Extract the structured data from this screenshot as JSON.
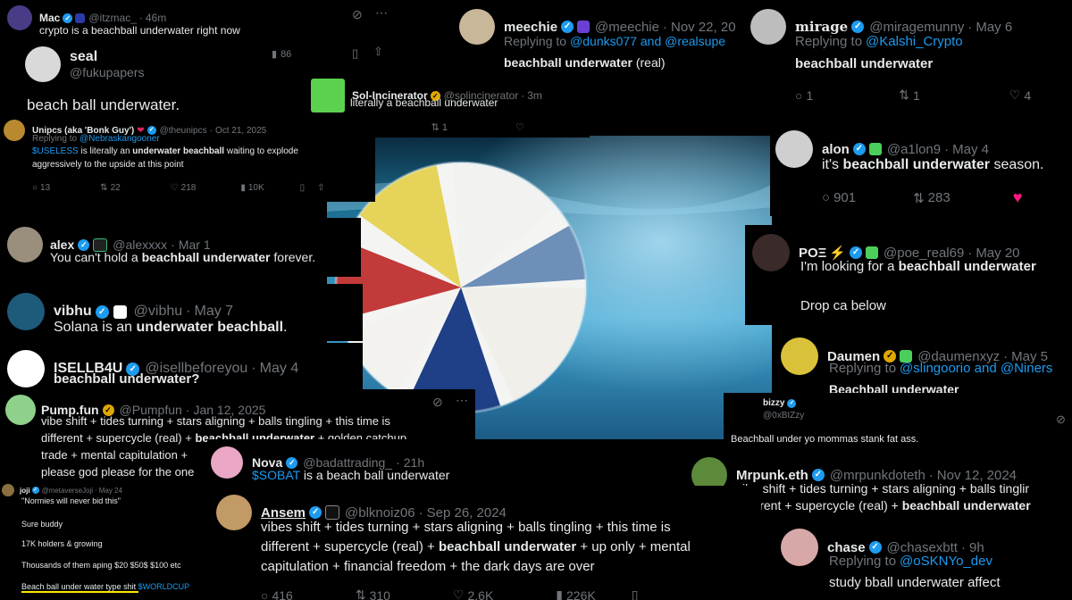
{
  "mac": {
    "name": "Mac",
    "handle": "@itzmac_",
    "time": "46m",
    "body": "crypto is a beachball underwater right now"
  },
  "seal": {
    "name": "seal",
    "handle": "@fukupapers",
    "views": "86",
    "body": "beach ball underwater."
  },
  "unipcs": {
    "name": "Unipcs (aka 'Bonk Guy')",
    "handle": "@theunipcs",
    "date": "Oct 21, 2025",
    "reply_prefix": "Replying to",
    "reply_to": "@Nebraskangooner",
    "cashtag": "$USELESS",
    "body_a": " is literally an ",
    "body_b": "underwater beachball",
    "body_c": " waiting to explode",
    "body_2": "aggressively to the upside at this point",
    "replies": "13",
    "reposts": "22",
    "likes": "218",
    "views": "10K"
  },
  "meechie": {
    "name": "meechie",
    "handle": "@meechie",
    "date": "Nov 22, 20",
    "reply_prefix": "Replying to",
    "reply_to": "@dunks077 and @realsupe",
    "body_bold": "beachball underwater",
    "body_rest": " (real)"
  },
  "mirage": {
    "name": "mirage",
    "handle": "@miragemunny",
    "date": "May 6",
    "reply_prefix": "Replying to",
    "reply_to": "@Kalshi_Crypto",
    "body": "beachball underwater",
    "replies": "1",
    "reposts": "1",
    "likes": "4"
  },
  "sol": {
    "name": "Sol-Incinerator",
    "handle": "@solincinerator",
    "time": "3m",
    "body": "literally a beachball underwater",
    "reposts": "1"
  },
  "alon": {
    "name": "alon",
    "handle": "@a1lon9",
    "date": "May 4",
    "body_a": "it's ",
    "body_bold": "beachball underwater",
    "body_c": " season.",
    "replies": "901",
    "reposts": "283"
  },
  "alex": {
    "name": "alex",
    "handle": "@alexxxx",
    "date": "Mar 1",
    "body_a": "You can't hold a ",
    "body_bold": "beachball underwater",
    "body_c": " forever."
  },
  "poe": {
    "name": "POΞ",
    "handle": "@poe_real69",
    "date": "May 20",
    "body_a": "I'm looking for a ",
    "body_bold": "beachball underwater",
    "body_2": "Drop ca below"
  },
  "vibhu": {
    "name": "vibhu",
    "handle": "@vibhu",
    "date": "May 7",
    "body_a": "Solana is an ",
    "body_bold": "underwater beachball",
    "body_c": "."
  },
  "daumen": {
    "name": "Daumen",
    "handle": "@daumenxyz",
    "date": "May 5",
    "reply_prefix": "Replying to",
    "reply_to": "@slingoorio and @Niners",
    "body": "Beachball underwater"
  },
  "isell": {
    "name": "ISELLB4U",
    "handle": "@isellbeforeyou",
    "date": "May 4",
    "body": "beachball underwater?"
  },
  "pump": {
    "name": "Pump.fun",
    "handle": "@Pumpfun",
    "date": "Jan 12, 2025",
    "line1": "vibe shift + tides turning + stars aligning + balls tingling + this time is",
    "line2_a": "different + supercycle (real) + ",
    "line2_bold": "beachball underwater",
    "line2_c": " + golden catchup",
    "line3": "trade + mental capitulation +",
    "line4": "please god please for the one"
  },
  "bizzy": {
    "name": "bizzy",
    "handle": "@0xBIZzy",
    "body": "Beachball under yo mommas stank fat ass."
  },
  "nova": {
    "name": "Nova",
    "handle": "@badattrading_",
    "time": "21h",
    "cashtag": "$SOBAT",
    "body": " is a beach ball underwater"
  },
  "mrpunk": {
    "name": "Mrpunk.eth",
    "handle": "@mrpunkdoteth",
    "date": "Nov 12, 2024",
    "line1": "vibe shift + tides turning + stars aligning + balls tinglir",
    "line2_a": "different + supercycle (real) + ",
    "line2_bold": "beachball underwater"
  },
  "joji": {
    "name": "joji",
    "handle": "@metaverseJoji",
    "date": "May 24",
    "quote": "\"Normies will never bid this\"",
    "l1": "Sure buddy",
    "l2": "17K holders & growing",
    "l3": "Thousands of them aping $20 $50$ $100 etc",
    "l4": "Beach ball under water type shit ",
    "l4_tag": "$WORLDCUP"
  },
  "ansem": {
    "name": "Ansem",
    "handle": "@blknoiz06",
    "date": "Sep 26, 2024",
    "line1": "vibes shift + tides turning + stars aligning + balls tingling + this time is",
    "line2_a": "different + supercycle (real) + ",
    "line2_bold": "beachball underwater",
    "line2_c": " + up only + mental",
    "line3": "capitulation + financial freedom + the dark days are over",
    "replies": "416",
    "reposts": "310",
    "likes": "2.6K",
    "views": "226K"
  },
  "chase": {
    "name": "chase",
    "handle": "@chasexbtt",
    "time": "9h",
    "reply_prefix": "Replying to",
    "reply_to": "@oSKNYo_dev",
    "body": "study bball underwater affect"
  },
  "icons": {
    "verified": "verified-badge-icon",
    "reply": "reply-icon",
    "repost": "repost-icon",
    "like": "like-icon",
    "views": "views-icon",
    "bookmark": "bookmark-icon",
    "share": "share-icon",
    "grok": "grok-icon"
  },
  "colors": {
    "verified": "#1d9bf0",
    "link": "#1d9bf0",
    "muted": "#71767b",
    "like_active": "#f91880",
    "gold": "#e0a800"
  }
}
